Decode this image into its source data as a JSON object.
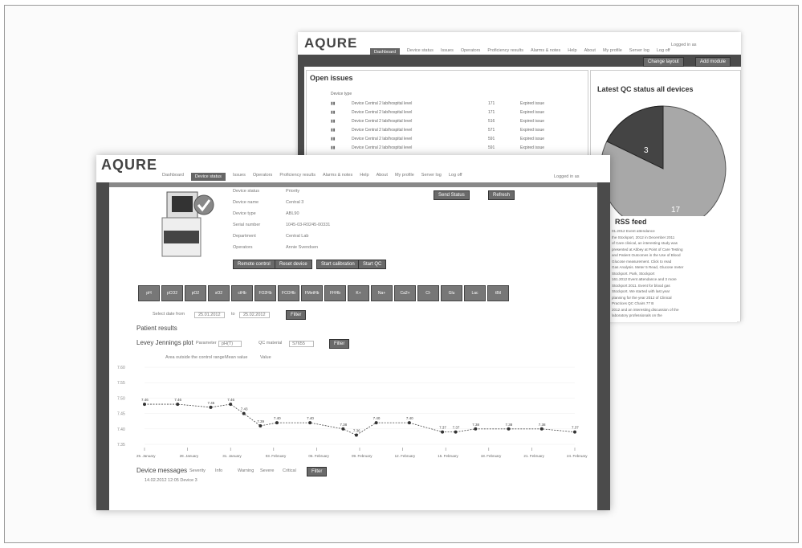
{
  "back": {
    "logo": "AQURE",
    "user": "Logged in as",
    "nav": [
      "Dashboard",
      "Device status",
      "Issues",
      "Operators",
      "Proficiency results",
      "Alarms & notes",
      "Help",
      "About",
      "My profile",
      "Server log",
      "Log off"
    ],
    "actions": [
      "Change layout",
      "Add module"
    ],
    "issues": {
      "title": "Open issues",
      "column": "Device type",
      "rows": [
        {
          "name": "Device Central 2 lab/hospital level",
          "num": "171",
          "status": "Expired issue"
        },
        {
          "name": "Device Central 2 lab/hospital level",
          "num": "171",
          "status": "Expired issue"
        },
        {
          "name": "Device Central 2 lab/hospital level",
          "num": "516",
          "status": "Expired issue"
        },
        {
          "name": "Device Central 2 lab/hospital level",
          "num": "571",
          "status": "Expired issue"
        },
        {
          "name": "Device Central 2 lab/hospital level",
          "num": "591",
          "status": "Expired issue"
        },
        {
          "name": "Device Central 2 lab/hospital level",
          "num": "591",
          "status": "Expired issue"
        }
      ]
    },
    "qc": {
      "title": "Latest QC status all devices",
      "dark_value": "3",
      "light_value": "17"
    },
    "rss": {
      "title": "RSS feed",
      "lines": [
        "01.2012 Event attendance",
        "the Stockport, 2012 in December 2011",
        "of Care clinical, an interesting study was",
        "presented at Abbey at Point of Care Testing",
        "and Patient Outcomes in the Use of Blood",
        "Glucose measurement. Click to read",
        "Gas Analysis. Meter 5 Read, Glucose meter",
        "Stockport. Park, Stockport",
        "161.2012 Event attendance and 3 more",
        "Stockport 2011. Event for blood gas",
        "Stockport. We started with last year",
        "planning for the year 2012 of Clinical",
        "Practices QC Chairs 77 B",
        "2012 and an interesting discussion of the",
        "laboratory professionals on the"
      ]
    }
  },
  "front": {
    "logo": "AQURE",
    "user": "Logged in as",
    "nav": [
      "Dashboard",
      "Device status",
      "Issues",
      "Operators",
      "Proficiency results",
      "Alarms & notes",
      "Help",
      "About",
      "My profile",
      "Server log",
      "Log off"
    ],
    "device_info": [
      {
        "label": "Device status",
        "value": "Priority"
      },
      {
        "label": "Device name",
        "value": "Central 3"
      },
      {
        "label": "Device type",
        "value": "ABL90"
      },
      {
        "label": "Serial number",
        "value": "1045-03-R0245-00331"
      },
      {
        "label": "Department",
        "value": "Central Lab"
      },
      {
        "label": "Operators",
        "value": "Annie Svendsen"
      }
    ],
    "right_buttons": [
      "Send Status",
      "Refresh"
    ],
    "action_buttons": [
      "Remote control",
      "Reset device",
      "Start calibration",
      "Start QC"
    ],
    "toolbar": [
      "pH",
      "pCO2",
      "pO2",
      "sO2",
      "ctHb",
      "FO2Hb",
      "FCOHb",
      "FMetHb",
      "FHHb",
      "K+",
      "Na+",
      "Ca2+",
      "Cl-",
      "Glu",
      "Lac",
      "tBil"
    ],
    "filter": {
      "label": "Select date from",
      "from": "25.01.2012",
      "to_label": "to",
      "to": "25.02.2012",
      "button": "Filter"
    },
    "patient_results": "Patient results",
    "levey": {
      "title": "Levey Jennings plot",
      "param_label": "Parameter",
      "param_value": "pH(T)",
      "qc_label": "QC material",
      "qc_value": "S7655",
      "button": "Filter",
      "legend": [
        "Area outside the control range",
        "Mean value",
        "Value"
      ]
    },
    "messages": {
      "title": "Device messages",
      "severity": "Severity",
      "types": [
        "Info",
        "Warning",
        "Severe",
        "Critical"
      ],
      "button": "Filter",
      "entry": "14.02.2012 12:05 Device 3"
    }
  },
  "chart_data": {
    "type": "line",
    "title": "",
    "ylim": [
      7.2,
      7.6
    ],
    "y_ticks": [
      "7.60",
      "7.55",
      "7.50",
      "7.45",
      "7.40",
      "7.35"
    ],
    "x_labels": [
      "25. January",
      "28. January",
      "31. January",
      "03. February",
      "06. February",
      "09. February",
      "12. February",
      "15. February",
      "18. February",
      "21. February",
      "24. February"
    ],
    "points": [
      {
        "x": 0,
        "y": 7.46,
        "label": "7.46"
      },
      {
        "x": 1,
        "y": 7.46,
        "label": "7.46"
      },
      {
        "x": 2,
        "y": 7.45,
        "label": "7.45"
      },
      {
        "x": 2.6,
        "y": 7.46,
        "label": "7.46"
      },
      {
        "x": 3,
        "y": 7.43,
        "label": "7.43"
      },
      {
        "x": 3.5,
        "y": 7.39,
        "label": "7.39"
      },
      {
        "x": 4,
        "y": 7.4,
        "label": "7.40"
      },
      {
        "x": 5,
        "y": 7.4,
        "label": "7.40"
      },
      {
        "x": 6,
        "y": 7.38,
        "label": "7.38"
      },
      {
        "x": 6.4,
        "y": 7.36,
        "label": "7.36"
      },
      {
        "x": 7,
        "y": 7.4,
        "label": "7.40"
      },
      {
        "x": 8,
        "y": 7.4,
        "label": "7.40"
      },
      {
        "x": 9,
        "y": 7.37,
        "label": "7.37"
      },
      {
        "x": 9.4,
        "y": 7.37,
        "label": "7.37"
      },
      {
        "x": 10,
        "y": 7.38,
        "label": "7.38"
      },
      {
        "x": 11,
        "y": 7.38,
        "label": "7.38"
      },
      {
        "x": 12,
        "y": 7.38,
        "label": "7.38"
      },
      {
        "x": 13,
        "y": 7.37,
        "label": "7.37"
      }
    ]
  }
}
